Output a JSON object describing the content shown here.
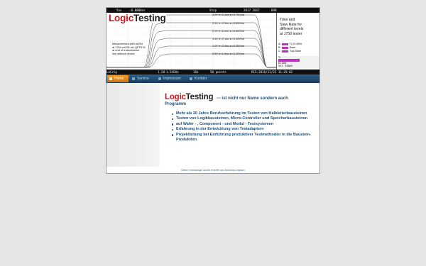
{
  "scope": {
    "topbar": [
      "5ns",
      "-0.0000ns",
      "Stop",
      "2017 2017",
      "BOB"
    ],
    "logo_part1": "Logic",
    "logo_part2": "Testing",
    "trace_labels": [
      "3.0V tr=2.4ns sr=0.75V/ns",
      "2.5V tr=2.3ns sr=0.65V/ns",
      "2.0V tr=2.2ns sr=0.55V/ns",
      "1.5V tr=2.1ns sr=0.45V/ns",
      "1.0V tr=2.0ns sr=0.35V/ns",
      "0.5V tr=1.9ns sr=0.25V/ns"
    ],
    "measurement_text": [
      "Measurement with wj334",
      "at J750-ch291 at LQFP176",
      "at end of transmission",
      "line without device"
    ],
    "panel_title": [
      "Trise and",
      "Slew Rate for",
      "different levels",
      "at J750 tester"
    ],
    "channels": [
      {
        "id": "A:",
        "text": "Tr 20-80%"
      },
      {
        "id": "B:",
        "text": "Base"
      },
      {
        "id": "C:",
        "text": "Top-Base"
      }
    ],
    "meter_lines": [
      "T:",
      "DC100",
      "VX1 338mV"
    ],
    "bottombar_left": "LeCroy",
    "bottombar": [
      "1.20",
      "1.54GHz",
      "16k",
      "50 points",
      "RIS:2016/11/23 11:25:02"
    ],
    "colors": {
      "logo_red": "#c8181f",
      "channel_magenta": "#c030c0"
    }
  },
  "nav": {
    "items": [
      {
        "label": "Home",
        "icon": "home-icon",
        "active": true
      },
      {
        "label": "Service",
        "icon": "service-icon",
        "active": false
      },
      {
        "label": "Impressum",
        "icon": "info-icon",
        "active": false
      },
      {
        "label": "Kontakt",
        "icon": "mail-icon",
        "active": false
      }
    ],
    "colors": {
      "bar": "#1f476c",
      "active": "#e0892a"
    }
  },
  "main": {
    "headline_part1": "Logic",
    "headline_part2": "Testing",
    "headline_rest": "--- ist nicht nur Name sondern auch",
    "headline_line2": "Programm",
    "bullets": [
      "Mehr als 20 Jahre Berufserfahrung im Testen von Halbleiterbausteinen",
      "Testen von Logikbausteinen, Micro-Controller und Speicherbausteinen",
      "auf Wafer - , Component - und Modul - Testsystemen",
      "Erfahrung in der Entwicklung von Testadaptern",
      "Projektleitung bei Einführung produktiver Testmethoden in die Baustein-Produktion"
    ]
  },
  "footer": {
    "text": "Diese Homepage wurde erstellt von Andreas Legisch"
  }
}
